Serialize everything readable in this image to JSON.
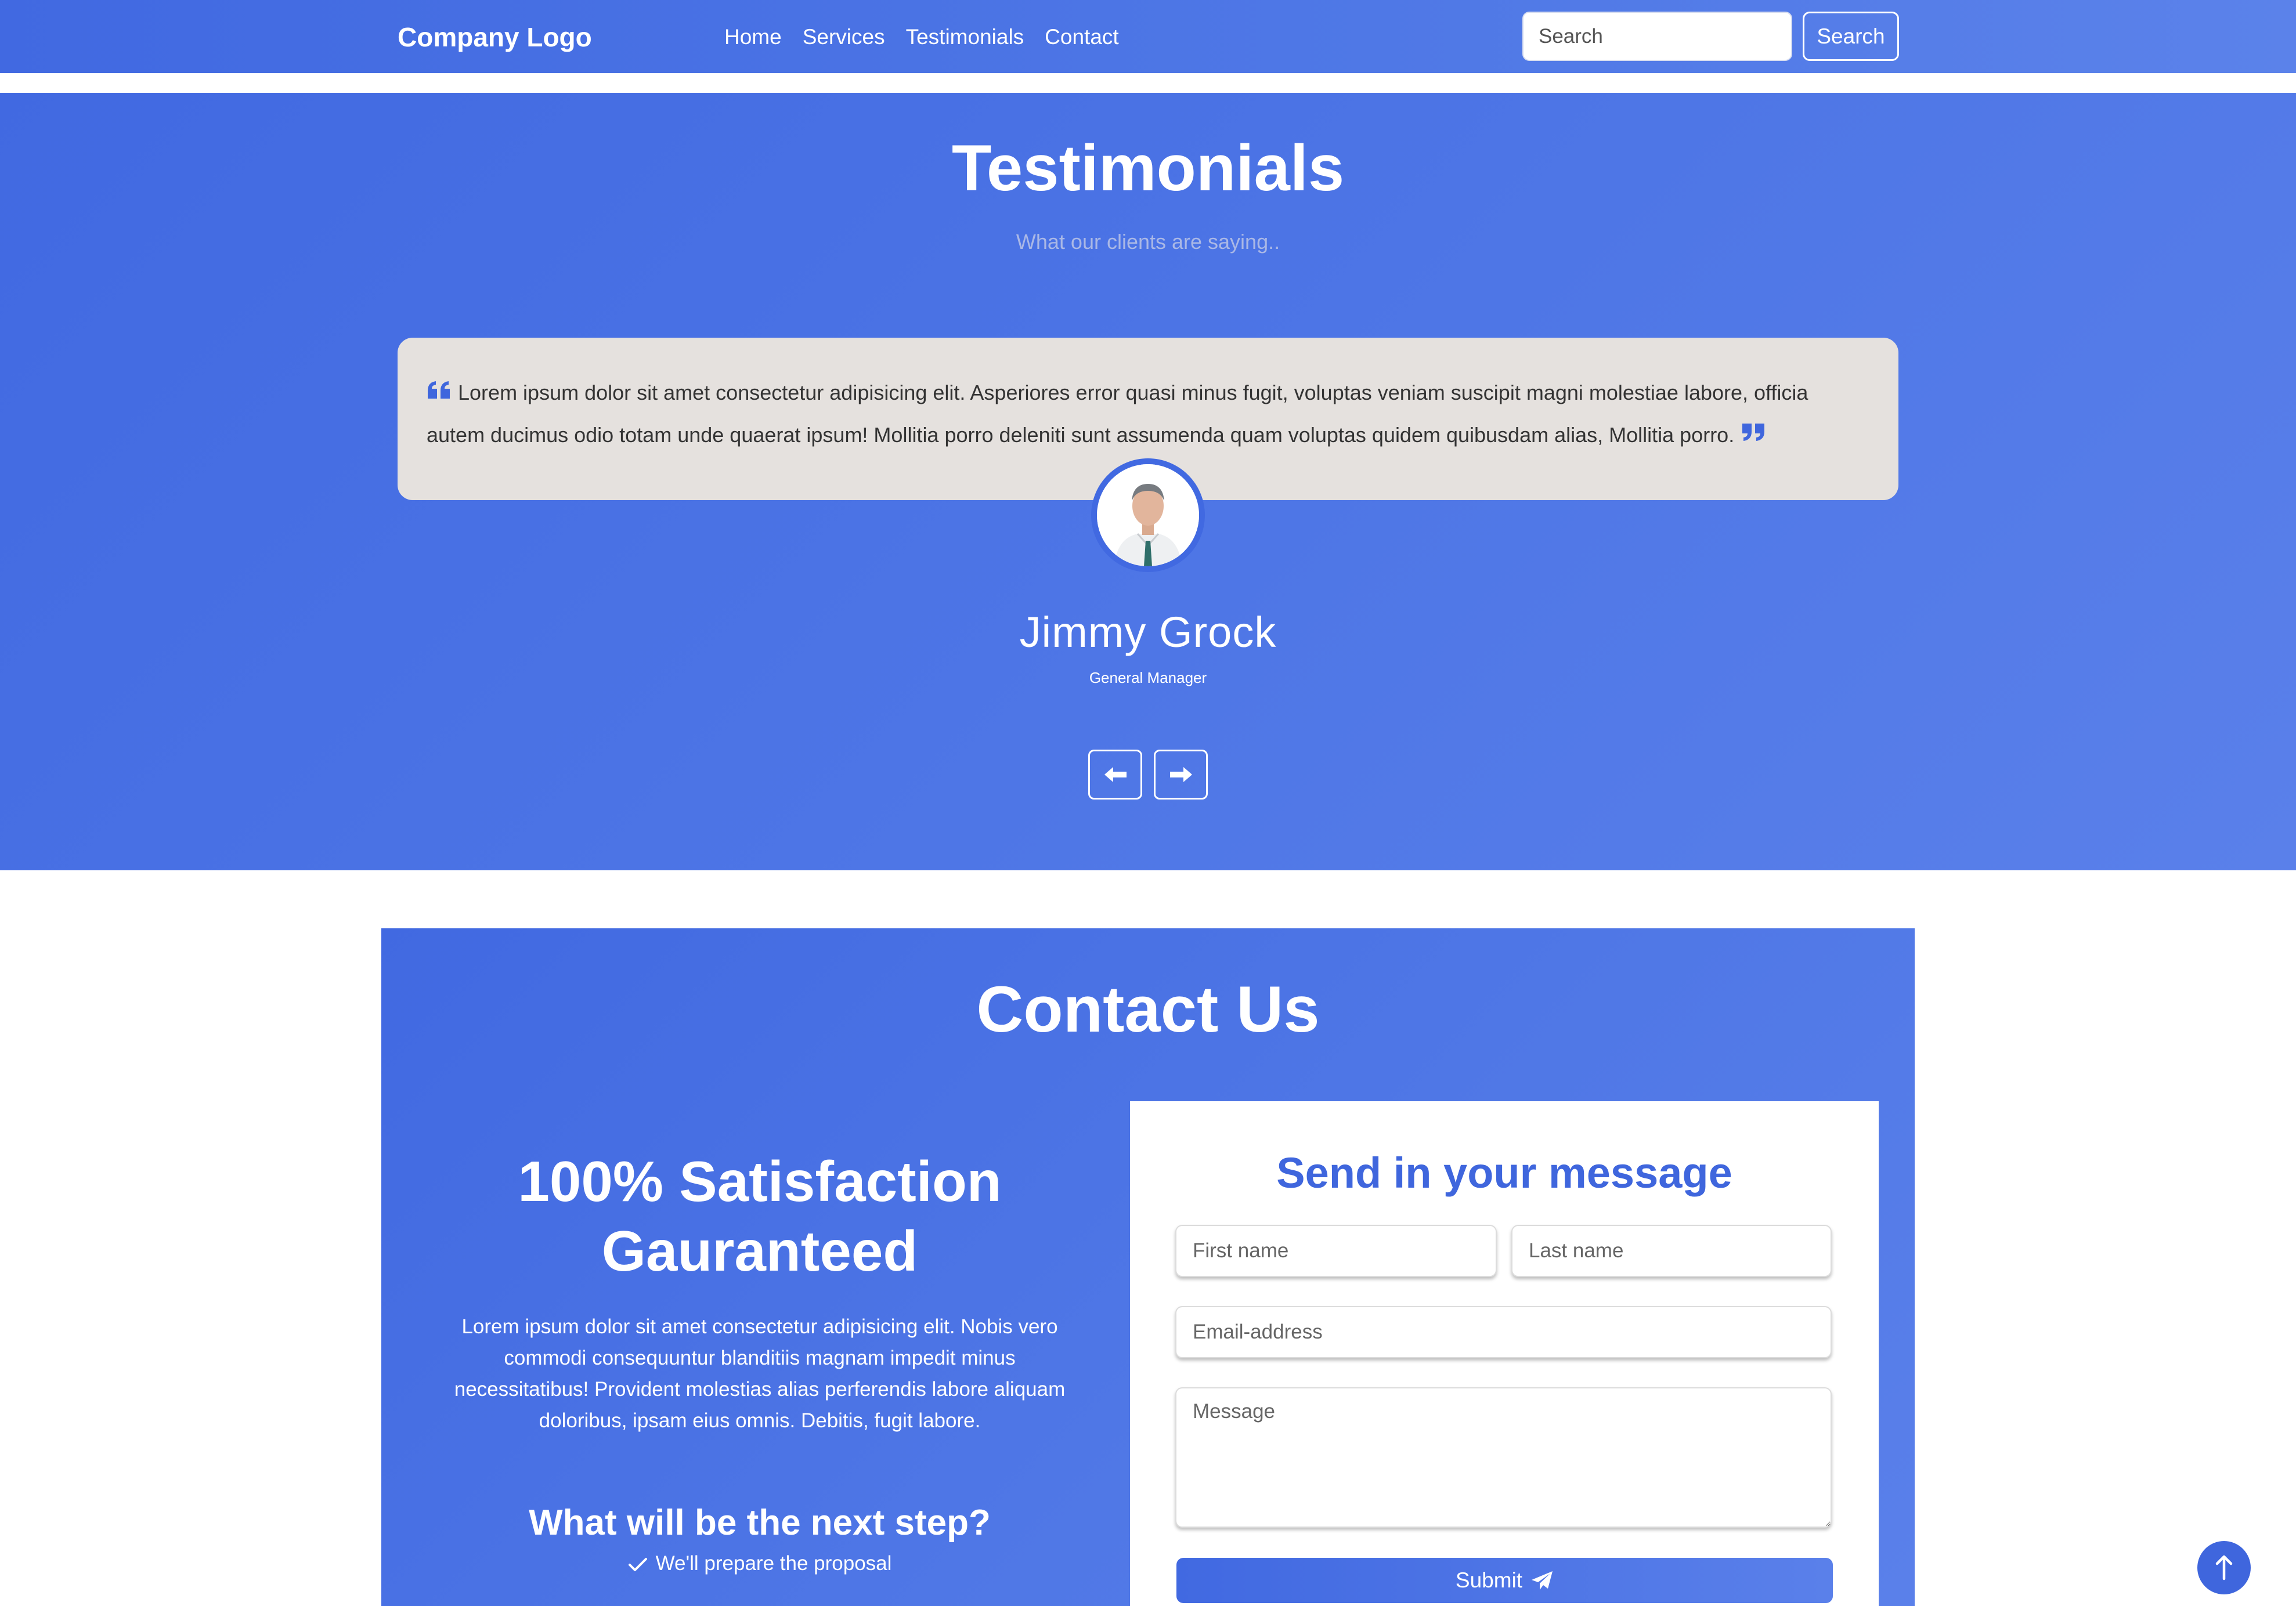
{
  "navbar": {
    "brand": "Company Logo",
    "links": [
      "Home",
      "Services",
      "Testimonials",
      "Contact"
    ],
    "search_placeholder": "Search",
    "search_button": "Search"
  },
  "testimonials": {
    "title": "Testimonials",
    "subtitle": "What our clients are saying..",
    "quote": "Lorem ipsum dolor sit amet consectetur adipisicing elit. Asperiores error quasi minus fugit, voluptas veniam suscipit magni molestiae labore, officia autem ducimus odio totam unde quaerat ipsum! Mollitia porro deleniti sunt assumenda quam voluptas quidem quibusdam alias, Mollitia porro.",
    "name": "Jimmy Grock",
    "role": "General Manager",
    "prev_icon": "arrow-left-icon",
    "next_icon": "arrow-right-icon"
  },
  "contact": {
    "title": "Contact Us",
    "satisfaction_title_line1": "100% Satisfaction",
    "satisfaction_title_line2": "Gauranteed",
    "satisfaction_text": "Lorem ipsum dolor sit amet consectetur adipisicing elit. Nobis vero commodi consequuntur blanditiis magnam impedit minus necessitatibus! Provident molestias alias perferendis labore aliquam doloribus, ipsam eius omnis. Debitis, fugit labore.",
    "next_step_title": "What will be the next step?",
    "next_steps": [
      "We'll prepare the proposal"
    ],
    "form": {
      "title": "Send in your message",
      "first_name_placeholder": "First name",
      "last_name_placeholder": "Last name",
      "email_placeholder": "Email-address",
      "message_placeholder": "Message",
      "submit_label": "Submit",
      "submit_icon": "paper-plane-icon"
    }
  },
  "colors": {
    "primary": "#4169e1",
    "primary_light": "#5a80ea",
    "card_bg": "#e5e1de",
    "subtitle": "#aab8e6"
  },
  "scroll_top_icon": "arrow-up-icon"
}
